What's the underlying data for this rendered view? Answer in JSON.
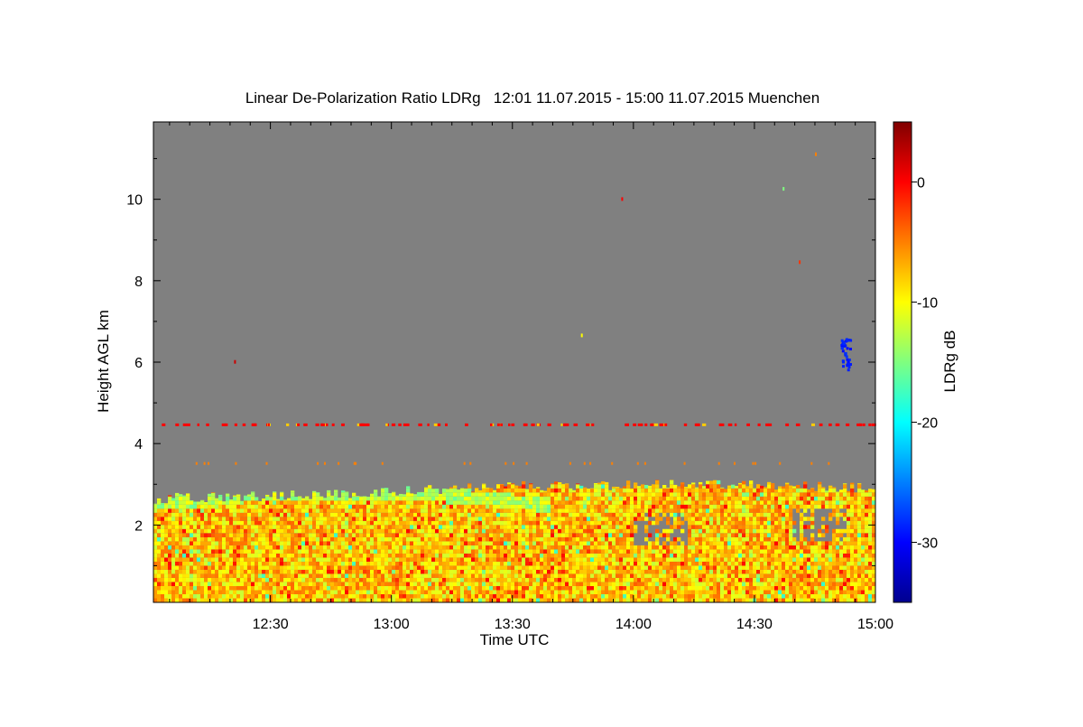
{
  "chart_data": {
    "type": "heatmap",
    "title": "Linear De-Polarization Ratio LDRg   12:01 11.07.2015 - 15:00 11.07.2015 Muenchen",
    "xlabel": "Time UTC",
    "ylabel": "Height AGL km",
    "xlim": [
      "12:01",
      "15:00"
    ],
    "ylim": [
      0.1,
      11.9
    ],
    "x_ticks": [
      "12:30",
      "13:00",
      "13:30",
      "14:00",
      "14:30",
      "15:00"
    ],
    "y_ticks": [
      2,
      4,
      6,
      8,
      10
    ],
    "colorbar": {
      "label": "LDRg dB",
      "range": [
        -35,
        5
      ],
      "ticks": [
        0,
        -10,
        -20,
        -30
      ],
      "colormap": "jet"
    },
    "no_data_color": "#808080",
    "features": [
      {
        "kind": "boundary layer aerosol",
        "height_km": [
          0.1,
          2.9
        ],
        "ldr_db": [
          -12,
          -6
        ],
        "dominant": "yellow/orange"
      },
      {
        "kind": "layer top (less depolarizing)",
        "height_km": [
          2.3,
          2.7
        ],
        "ldr_db": [
          -20,
          -14
        ]
      },
      {
        "kind": "sparse returns",
        "height_km": 4.45,
        "ldr_db": 0
      },
      {
        "kind": "sparse returns",
        "height_km": 3.5,
        "ldr_db": -5
      },
      {
        "kind": "ice cloud patch",
        "time": "14:52",
        "height_km": [
          5.8,
          6.6
        ],
        "ldr_db": -30
      }
    ]
  }
}
